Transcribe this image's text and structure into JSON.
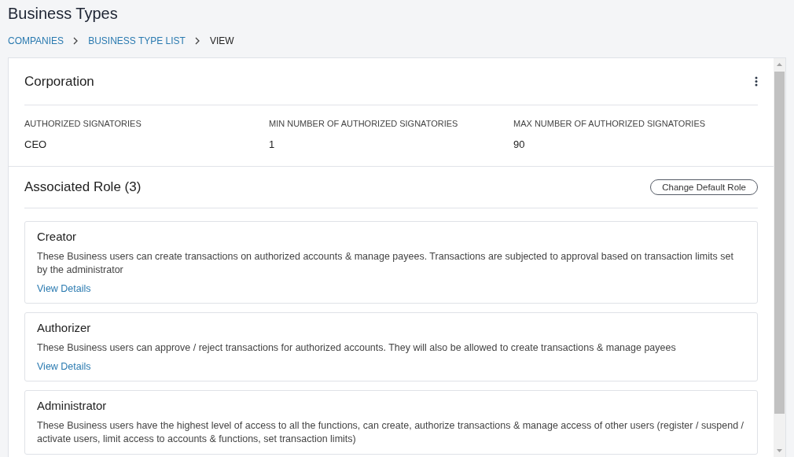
{
  "page_title": "Business Types",
  "breadcrumb": [
    {
      "label": "COMPANIES",
      "kind": "link"
    },
    {
      "label": "BUSINESS TYPE LIST",
      "kind": "link"
    },
    {
      "label": "VIEW",
      "kind": "current"
    }
  ],
  "business_type": {
    "name": "Corporation",
    "fields": [
      {
        "label": "AUTHORIZED SIGNATORIES",
        "value": "CEO"
      },
      {
        "label": "MIN NUMBER OF AUTHORIZED SIGNATORIES",
        "value": "1"
      },
      {
        "label": "MAX NUMBER OF AUTHORIZED SIGNATORIES",
        "value": "90"
      }
    ]
  },
  "roles_section": {
    "title": "Associated Role (3)",
    "button": "Change Default Role",
    "roles": [
      {
        "name": "Creator",
        "description": "These Business users can create transactions on authorized accounts & manage payees. Transactions are subjected to approval based on transaction limits set by the administrator",
        "link": "View Details"
      },
      {
        "name": "Authorizer",
        "description": "These Business users can approve / reject transactions for authorized accounts. They will also be allowed to create transactions & manage payees",
        "link": "View Details"
      },
      {
        "name": "Administrator",
        "description": "These Business users have the highest level of access to all the functions, can create, authorize transactions & manage access of other users (register / suspend / activate users, limit access to accounts & functions, set transaction limits)"
      }
    ]
  }
}
